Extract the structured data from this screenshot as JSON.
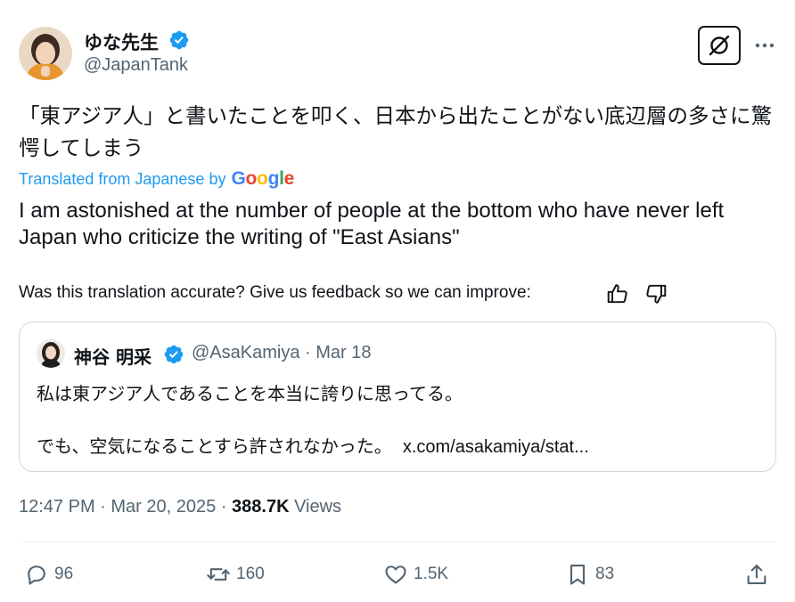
{
  "author": {
    "display_name": "ゆな先生",
    "handle": "@JapanTank",
    "verified": true,
    "avatar_icon": "avatar-photo-icon"
  },
  "header_buttons": {
    "grok_icon": "grok-icon",
    "more_icon": "more-dots-icon"
  },
  "tweet": {
    "original_text": "「東アジア人」と書いたことを叩く、日本から出たことがない底辺層の多さに驚愕してしまう",
    "translated_label": "Translated from Japanese by",
    "translator": "Google",
    "translated_text": "I am astonished at the number of people at the bottom who have never left Japan who criticize the writing of \"East Asians\"",
    "feedback_prompt": "Was this translation accurate? Give us feedback so we can improve:"
  },
  "quoted_tweet": {
    "display_name": "神谷 明采",
    "handle_date": "@AsaKamiya · Mar 18",
    "line1": "私は東アジア人であることを本当に誇りに思ってる。",
    "line2": "でも、空気になることすら許されなかった。",
    "link": "x.com/asakamiya/stat..."
  },
  "meta": {
    "timestamp": "12:47 PM · Mar 20, 2025 · ",
    "views_count": "388.7K",
    "views_label": " Views"
  },
  "actions": {
    "replies": "96",
    "reposts": "160",
    "likes": "1.5K",
    "bookmarks": "83"
  },
  "colors": {
    "accent": "#1d9bf0",
    "secondary_text": "#536471",
    "border": "#cfd9de"
  }
}
